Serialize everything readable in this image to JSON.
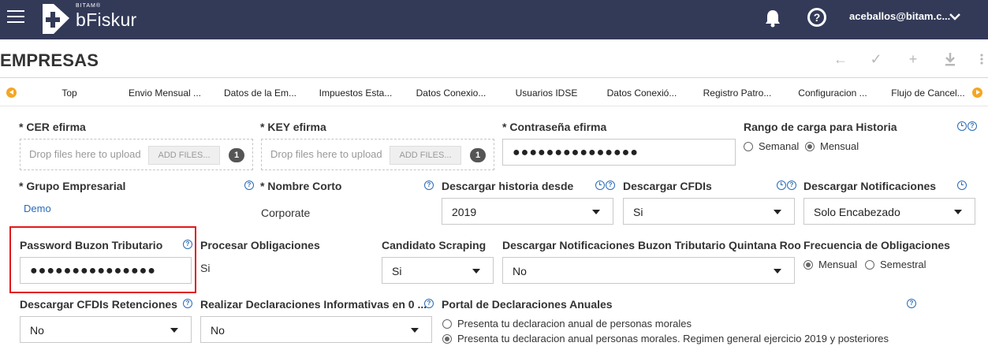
{
  "header": {
    "brand_small": "BITAM®",
    "brand_name": "bFiskur",
    "user": "aceballos@bitam.c..."
  },
  "page": {
    "title": "EMPRESAS"
  },
  "toolbar": {
    "icons": [
      "back-arrow-icon",
      "check-icon",
      "plus-icon",
      "download-icon",
      "more-vertical-icon"
    ]
  },
  "tabs": [
    "Top",
    "Envio Mensual ...",
    "Datos de la Em...",
    "Impuestos Esta...",
    "Datos Conexio...",
    "Usuarios IDSE",
    "Datos Conexió...",
    "Registro Patro...",
    "Configuracion ...",
    "Flujo de Cancel..."
  ],
  "form": {
    "cer": {
      "label": "* CER efirma",
      "drop_text": "Drop files here to upload",
      "button": "ADD FILES...",
      "count": "1"
    },
    "key": {
      "label": "* KEY efirma",
      "drop_text": "Drop files here to upload",
      "button": "ADD FILES...",
      "count": "1"
    },
    "contrasena": {
      "label": "* Contraseña efirma",
      "value": "●●●●●●●●●●●●●●●"
    },
    "rango": {
      "label": "Rango de carga para Historia",
      "options": [
        "Semanal",
        "Mensual"
      ],
      "selected": "Mensual"
    },
    "grupo": {
      "label": "* Grupo Empresarial",
      "value": "Demo"
    },
    "nombre_corto": {
      "label": "* Nombre Corto",
      "value": "Corporate"
    },
    "descargar_historia": {
      "label": "Descargar historia desde",
      "value": "2019"
    },
    "descargar_cfdis": {
      "label": "Descargar CFDIs",
      "value": "Si"
    },
    "descargar_notificaciones": {
      "label": "Descargar Notificaciones",
      "value": "Solo Encabezado"
    },
    "password_buzon": {
      "label": "Password Buzon Tributario",
      "value": "●●●●●●●●●●●●●●●"
    },
    "procesar_obligaciones": {
      "label": "Procesar Obligaciones",
      "value": "Si"
    },
    "candidato_scraping": {
      "label": "Candidato Scraping",
      "value": "Si"
    },
    "notif_buzon_qroo": {
      "label": "Descargar Notificaciones Buzon Tributario Quintana Roo",
      "value": "No"
    },
    "frecuencia": {
      "label": "Frecuencia de Obligaciones",
      "options": [
        "Mensual",
        "Semestral"
      ],
      "selected": "Mensual"
    },
    "cfdis_retenciones": {
      "label": "Descargar CFDIs Retenciones",
      "value": "No"
    },
    "declaraciones_informativas": {
      "label": "Realizar Declaraciones Informativas en 0 ...",
      "value": "No"
    },
    "portal_anuales": {
      "label": "Portal de Declaraciones Anuales",
      "options": [
        "Presenta tu declaracion anual de personas morales",
        "Presenta tu declaracion anual personas morales. Regimen general ejercicio 2019 y posteriores"
      ],
      "selected": "Presenta tu declaracion anual personas morales. Regimen general ejercicio 2019 y posteriores"
    }
  },
  "colors": {
    "header_bg": "#333a58",
    "accent": "#2a6bb5",
    "tab_arrow": "#f5a623",
    "highlight": "#e0191d"
  }
}
